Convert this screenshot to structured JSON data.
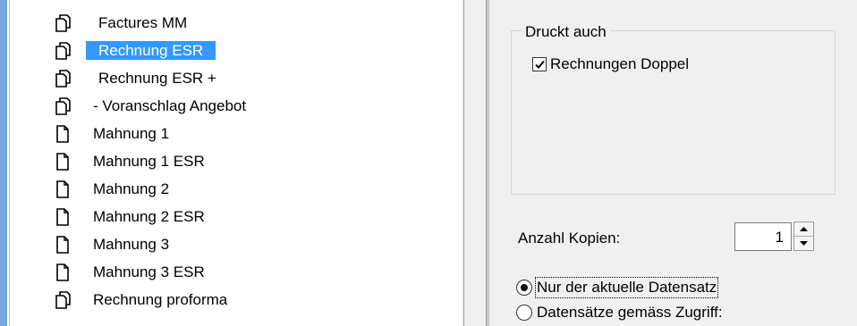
{
  "report_list": {
    "items": [
      {
        "label": "Factures MM",
        "icon": "multi-document-icon",
        "selected": false
      },
      {
        "label": "Rechnung ESR",
        "icon": "multi-document-icon",
        "selected": true
      },
      {
        "label": "Rechnung ESR +",
        "icon": "multi-document-icon",
        "selected": false
      },
      {
        "label": "- Voranschlag Angebot",
        "icon": "multi-document-icon",
        "selected": false
      },
      {
        "label": "Mahnung 1",
        "icon": "document-icon",
        "selected": false
      },
      {
        "label": "Mahnung 1 ESR",
        "icon": "document-icon",
        "selected": false
      },
      {
        "label": "Mahnung 2",
        "icon": "document-icon",
        "selected": false
      },
      {
        "label": "Mahnung 2 ESR",
        "icon": "document-icon",
        "selected": false
      },
      {
        "label": "Mahnung 3",
        "icon": "document-icon",
        "selected": false
      },
      {
        "label": "Mahnung 3 ESR",
        "icon": "document-icon",
        "selected": false
      },
      {
        "label": "Rechnung proforma",
        "icon": "multi-document-icon",
        "selected": false
      }
    ]
  },
  "options": {
    "group_title": "Druckt auch",
    "checkbox_label": "Rechnungen Doppel",
    "checkbox_checked": true,
    "copies_label": "Anzahl Kopien:",
    "copies_value": "1",
    "radio_current": "Nur der aktuelle Datensatz",
    "radio_access": "Datensätze gemäss Zugriff:",
    "selected_radio": "current"
  },
  "colors": {
    "selection": "#3399ff",
    "panel_background": "#f0f0f0",
    "left_accent": "#7aa7e0"
  }
}
